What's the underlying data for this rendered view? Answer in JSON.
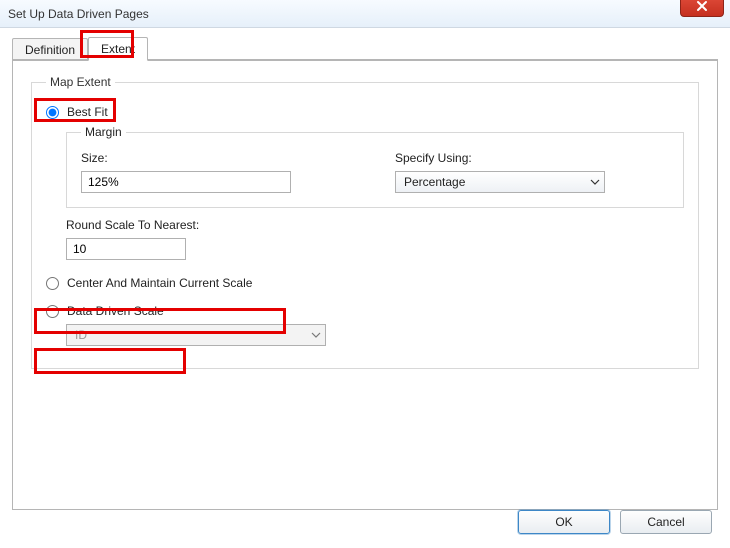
{
  "window": {
    "title": "Set Up Data Driven Pages"
  },
  "tabs": {
    "definition": "Definition",
    "extent": "Extent"
  },
  "mapExtent": {
    "legend": "Map Extent",
    "bestFit": {
      "label": "Best Fit"
    },
    "margin": {
      "legend": "Margin",
      "sizeLabel": "Size:",
      "sizeValue": "125%",
      "specifyLabel": "Specify Using:",
      "specifySelected": "Percentage"
    },
    "roundScale": {
      "label": "Round Scale To Nearest:",
      "value": "10"
    },
    "centerMaintain": {
      "label": "Center And Maintain Current Scale"
    },
    "dataDrivenScale": {
      "label": "Data Driven Scale",
      "fieldSelected": "ID"
    }
  },
  "footer": {
    "ok": "OK",
    "cancel": "Cancel"
  }
}
